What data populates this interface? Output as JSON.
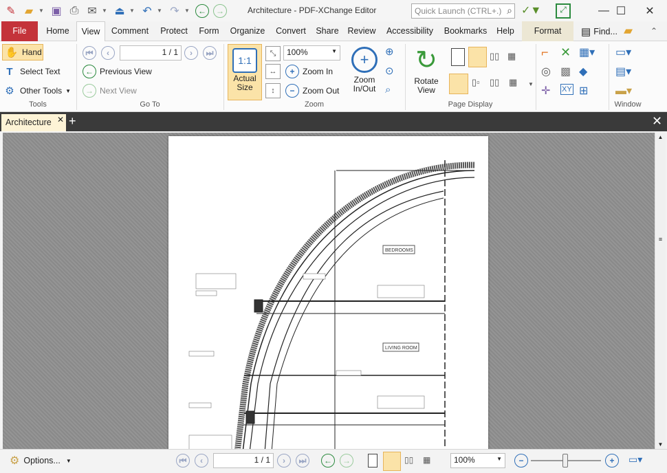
{
  "window": {
    "title": "Architecture - PDF-XChange Editor",
    "quick_launch_placeholder": "Quick Launch (CTRL+.)"
  },
  "menu_tabs": [
    "File",
    "Home",
    "View",
    "Comment",
    "Protect",
    "Form",
    "Organize",
    "Convert",
    "Share",
    "Review",
    "Accessibility",
    "Bookmarks",
    "Help",
    "Format"
  ],
  "find_label": "Find...",
  "tools": {
    "hand": "Hand",
    "select_text": "Select Text",
    "other_tools": "Other Tools",
    "group": "Tools"
  },
  "goto": {
    "page_value": "1 / 1",
    "previous_view": "Previous View",
    "next_view": "Next View",
    "group": "Go To"
  },
  "zoom": {
    "actual_size": "Actual Size",
    "zoom_value": "100%",
    "zoom_in": "Zoom In",
    "zoom_out": "Zoom Out",
    "zoom_inout": "Zoom In/Out",
    "group": "Zoom"
  },
  "page_display": {
    "rotate_view": "Rotate View",
    "group": "Page Display"
  },
  "window_group": "Window",
  "doc_tab": "Architecture",
  "status": {
    "options": "Options...",
    "page_value": "1 / 1",
    "zoom_value": "100%"
  },
  "drawing_labels": {
    "bedrooms": "BEDROOMS",
    "living_room": "LIVING ROOM"
  }
}
